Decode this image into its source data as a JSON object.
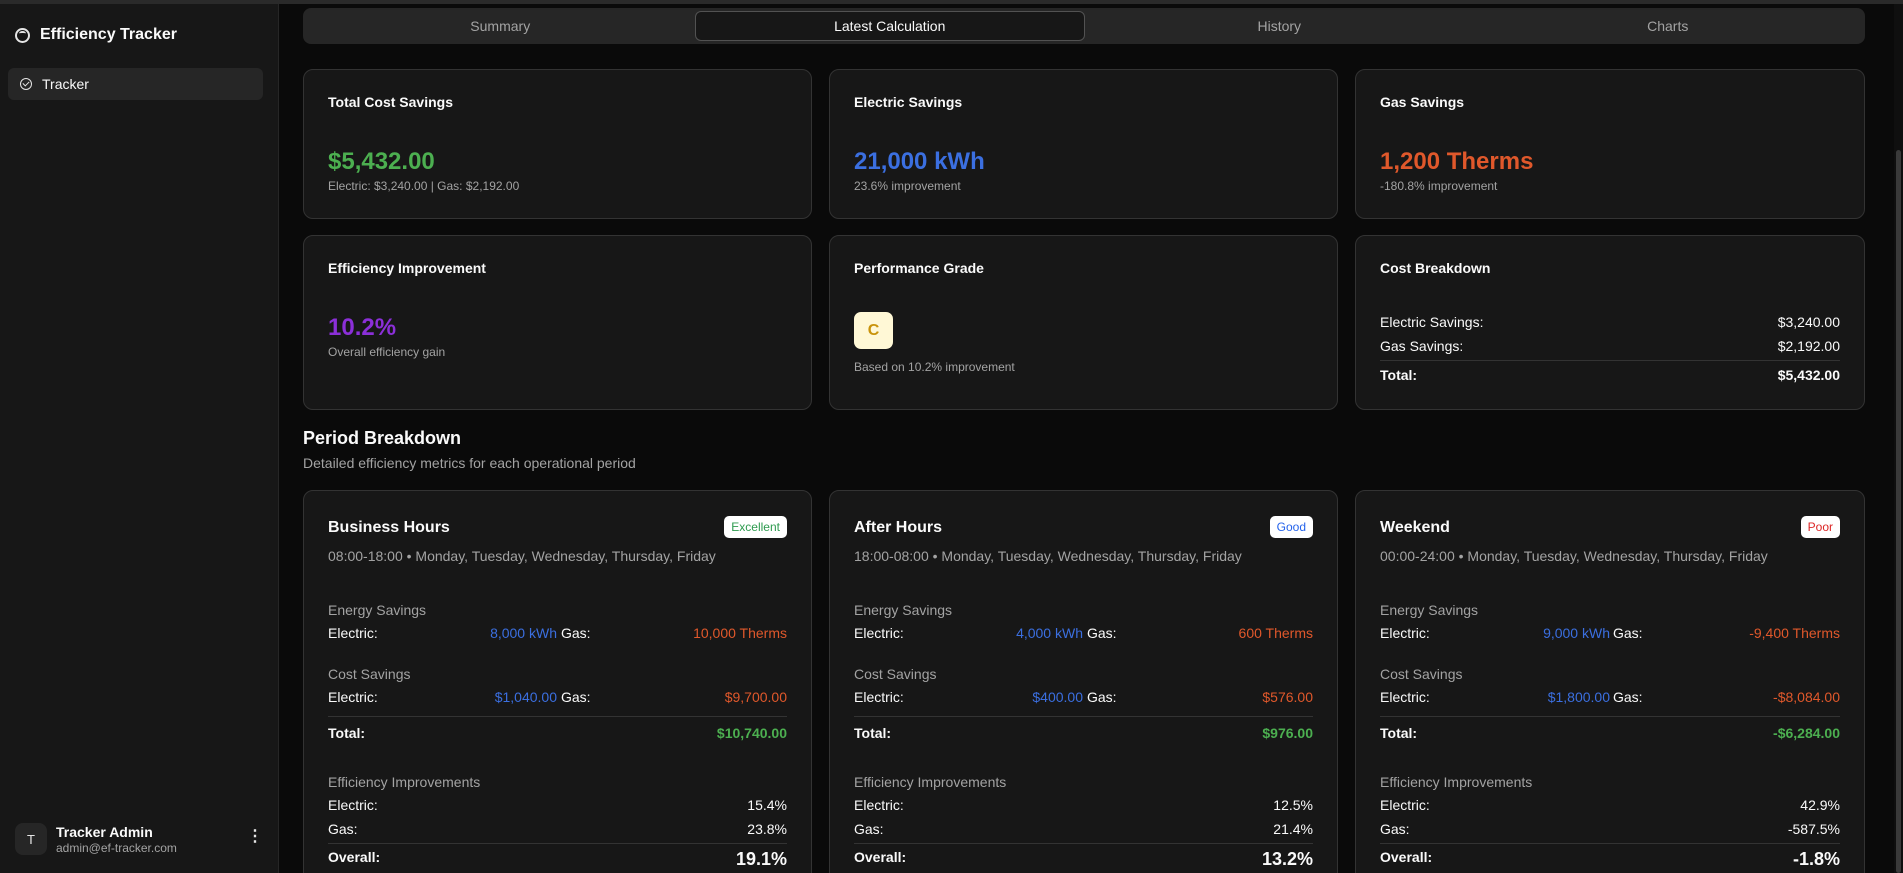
{
  "app": {
    "title": "Efficiency Tracker"
  },
  "sidebar": {
    "items": [
      {
        "label": "Tracker",
        "icon": "gauge-icon"
      }
    ]
  },
  "user": {
    "initial": "T",
    "name": "Tracker Admin",
    "email": "admin@ef-tracker.com"
  },
  "tabs": [
    {
      "label": "Summary",
      "active": false
    },
    {
      "label": "Latest Calculation",
      "active": true
    },
    {
      "label": "History",
      "active": false
    },
    {
      "label": "Charts",
      "active": false
    }
  ],
  "cards": {
    "total_cost": {
      "title": "Total Cost Savings",
      "value": "$5,432.00",
      "sub": "Electric: $3,240.00 | Gas: $2,192.00"
    },
    "electric": {
      "title": "Electric Savings",
      "value": "21,000 kWh",
      "sub": "23.6% improvement"
    },
    "gas": {
      "title": "Gas Savings",
      "value": "1,200 Therms",
      "sub": "-180.8% improvement"
    },
    "efficiency": {
      "title": "Efficiency Improvement",
      "value": "10.2%",
      "sub": "Overall efficiency gain"
    },
    "grade": {
      "title": "Performance Grade",
      "value": "C",
      "sub": "Based on 10.2% improvement"
    },
    "breakdown": {
      "title": "Cost Breakdown",
      "rows": [
        {
          "label": "Electric Savings:",
          "value": "$3,240.00"
        },
        {
          "label": "Gas Savings:",
          "value": "$2,192.00"
        }
      ],
      "total_label": "Total:",
      "total_value": "$5,432.00"
    }
  },
  "period_section": {
    "title": "Period Breakdown",
    "subtitle": "Detailed efficiency metrics for each operational period"
  },
  "labels": {
    "energy_savings": "Energy Savings",
    "cost_savings": "Cost Savings",
    "efficiency_improvements": "Efficiency Improvements",
    "electric": "Electric:",
    "gas": "Gas:",
    "total": "Total:",
    "overall": "Overall:"
  },
  "periods": [
    {
      "name": "Business Hours",
      "badge": "Excellent",
      "badge_color": "#2e9b4f",
      "desc": "08:00-18:00 • Monday, Tuesday, Wednesday, Thursday, Friday",
      "energy_electric": "8,000 kWh",
      "energy_gas": "10,000 Therms",
      "cost_electric": "$1,040.00",
      "cost_gas": "$9,700.00",
      "cost_total": "$10,740.00",
      "eff_electric": "15.4%",
      "eff_gas": "23.8%",
      "eff_overall": "19.1%"
    },
    {
      "name": "After Hours",
      "badge": "Good",
      "badge_color": "#2563eb",
      "desc": "18:00-08:00 • Monday, Tuesday, Wednesday, Thursday, Friday",
      "energy_electric": "4,000 kWh",
      "energy_gas": "600 Therms",
      "cost_electric": "$400.00",
      "cost_gas": "$576.00",
      "cost_total": "$976.00",
      "eff_electric": "12.5%",
      "eff_gas": "21.4%",
      "eff_overall": "13.2%"
    },
    {
      "name": "Weekend",
      "badge": "Poor",
      "badge_color": "#dc2626",
      "desc": "00:00-24:00 • Monday, Tuesday, Wednesday, Thursday, Friday",
      "energy_electric": "9,000 kWh",
      "energy_gas": "-9,400 Therms",
      "cost_electric": "$1,800.00",
      "cost_gas": "-$8,084.00",
      "cost_total": "-$6,284.00",
      "eff_electric": "42.9%",
      "eff_gas": "-587.5%",
      "eff_overall": "-1.8%"
    }
  ],
  "colors": {
    "background": "#0a0a0a",
    "card": "#171717",
    "green": "#4caf50",
    "blue": "#3b6fe0",
    "orange": "#e0582b",
    "purple": "#8b2fd8",
    "grade_bg": "#fff8d6",
    "grade_text": "#c9930a"
  }
}
